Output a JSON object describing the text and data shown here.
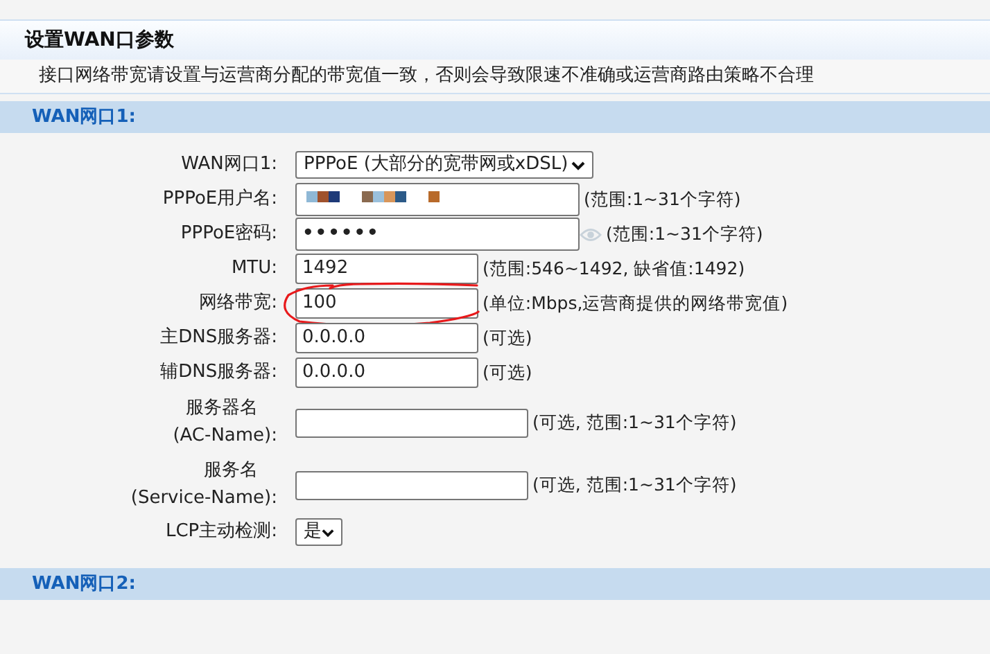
{
  "page_title": "设置WAN口参数",
  "notice": "接口网络带宽请设置与运营商分配的带宽值一致，否则会导致限速不准确或运营商路由策略不合理",
  "sections": [
    {
      "title": "WAN网口1:",
      "fields": [
        {
          "kind": "select",
          "label": "WAN网口1:",
          "value": "PPPoE (大部分的宽带网或xDSL)"
        },
        {
          "kind": "text",
          "label": "PPPoE用户名:",
          "mosaic": true,
          "hint": "(范围:1~31个字符)"
        },
        {
          "kind": "password",
          "label": "PPPoE密码:",
          "value": "••••••",
          "reveal_icon": true,
          "hint": "(范围:1~31个字符)"
        },
        {
          "kind": "text",
          "label": "MTU:",
          "value": "1492",
          "hint": "(范围:546~1492, 缺省值:1492)"
        },
        {
          "kind": "text",
          "label": "网络带宽:",
          "value": "100",
          "circled": true,
          "hint": "(单位:Mbps,运营商提供的网络带宽值)"
        },
        {
          "kind": "text",
          "label": "主DNS服务器:",
          "value": "0.0.0.0",
          "hint": "(可选)"
        },
        {
          "kind": "text",
          "label": "辅DNS服务器:",
          "value": "0.0.0.0",
          "hint": "(可选)"
        },
        {
          "kind": "text",
          "label": "服务器名",
          "label_line_2": "(AC-Name):",
          "hint": "(可选, 范围:1~31个字符)"
        },
        {
          "kind": "text",
          "label": "服务名",
          "label_line_2": "(Service-Name):",
          "hint": "(可选, 范围:1~31个字符)"
        },
        {
          "kind": "select",
          "label": "LCP主动检测:",
          "value": "是"
        }
      ]
    },
    {
      "title": "WAN网口2:"
    }
  ]
}
